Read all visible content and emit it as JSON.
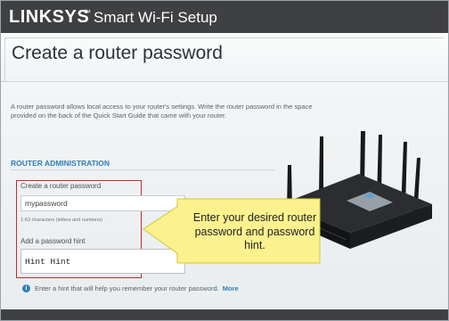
{
  "header": {
    "brand": "LINKSYS",
    "trademark": "™",
    "product": "Smart Wi-Fi Setup"
  },
  "page": {
    "title": "Create a router password",
    "description": "A router password allows local access to your router's settings. Write the router password in the space provided on the back of the Quick Start Guide that came with your router."
  },
  "section": {
    "label": "ROUTER ADMINISTRATION"
  },
  "form": {
    "password_label": "Create a router password",
    "password_value": "mypassword",
    "password_help": "1-63 characters (letters and numbers)",
    "hint_label": "Add a password hint",
    "hint_value": "Hint Hint"
  },
  "info": {
    "icon": "info-icon",
    "glyph": "i",
    "text": "Enter a hint that will help you remember your router password.",
    "link": "More"
  },
  "callout": {
    "text": "Enter your desired router password and password hint."
  },
  "colors": {
    "header_bar": "#3f4042",
    "accent_blue": "#2f7fb8",
    "highlight_red": "#c82a2a",
    "callout_fill": "#fbf18e"
  }
}
